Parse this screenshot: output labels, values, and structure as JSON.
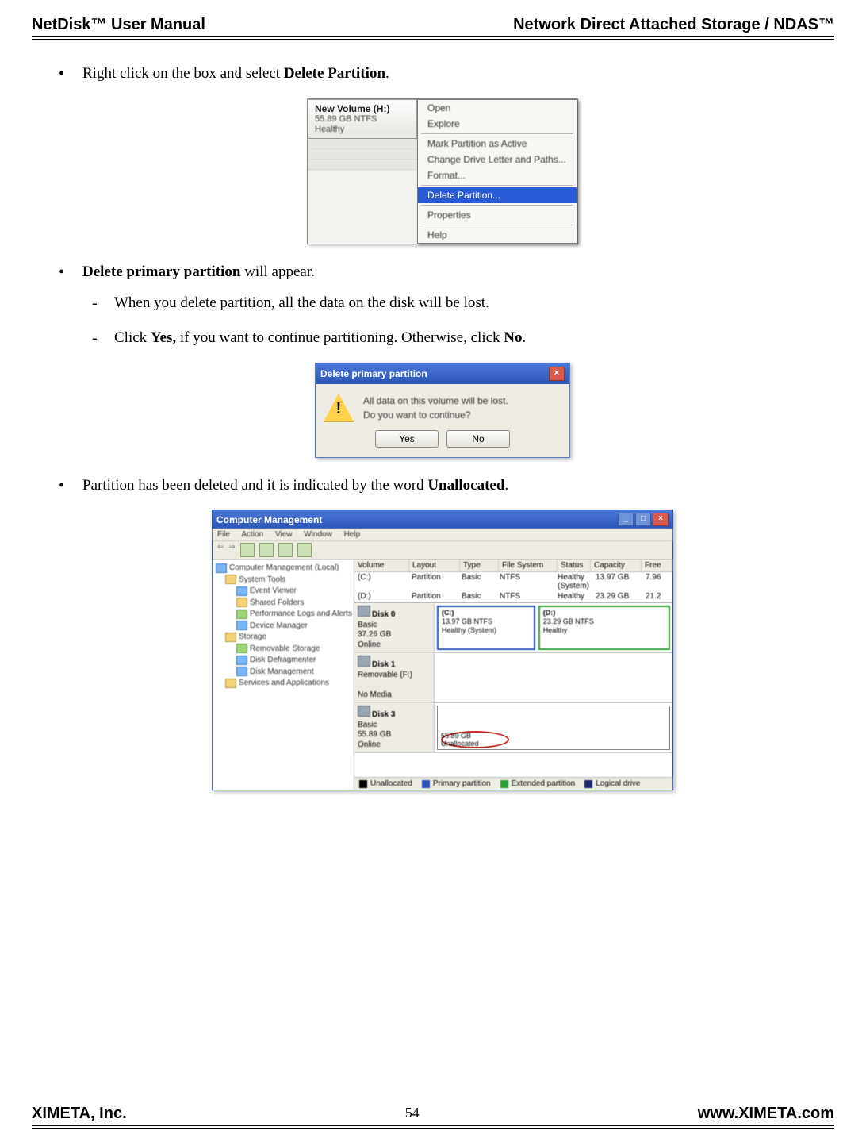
{
  "header": {
    "left": "NetDisk™ User Manual",
    "right": "Network Direct Attached Storage / NDAS™"
  },
  "footer": {
    "left": "XIMETA, Inc.",
    "page": "54",
    "right": "www.XIMETA.com"
  },
  "body": {
    "b1_pre": "Right click on the box and select ",
    "b1_bold": "Delete Partition",
    "b1_post": ".",
    "b2_bold": "Delete primary partition",
    "b2_post": " will appear.",
    "b2_d1": "When you delete partition, all the data on the disk will be lost.",
    "b2_d2_pre": "Click ",
    "b2_d2_bold1": "Yes,",
    "b2_d2_mid": " if you want to continue partitioning.  Otherwise, click ",
    "b2_d2_bold2": "No",
    "b2_d2_post": ".",
    "b3_pre": "Partition has been deleted and it is indicated by the word ",
    "b3_bold": "Unallocated",
    "b3_post": "."
  },
  "ss1": {
    "vol_line1": "New Volume  (H:)",
    "vol_line2": "55.89 GB NTFS",
    "vol_line3": "Healthy",
    "menu": {
      "open": "Open",
      "explore": "Explore",
      "mark": "Mark Partition as Active",
      "change": "Change Drive Letter and Paths...",
      "format": "Format...",
      "delete": "Delete Partition...",
      "properties": "Properties",
      "help": "Help"
    }
  },
  "ss2": {
    "title": "Delete primary partition",
    "msg1": "All data on this volume will be lost.",
    "msg2": "Do you want to continue?",
    "yes": "Yes",
    "no": "No"
  },
  "ss3": {
    "title": "Computer Management",
    "menu": {
      "file": "File",
      "action": "Action",
      "view": "View",
      "window": "Window",
      "help": "Help"
    },
    "tree": {
      "root": "Computer Management (Local)",
      "systools": "System Tools",
      "eventviewer": "Event Viewer",
      "shared": "Shared Folders",
      "perf": "Performance Logs and Alerts",
      "devmgr": "Device Manager",
      "storage": "Storage",
      "removable": "Removable Storage",
      "defrag": "Disk Defragmenter",
      "diskmgmt": "Disk Management",
      "services": "Services and Applications"
    },
    "cols": {
      "volume": "Volume",
      "layout": "Layout",
      "type": "Type",
      "fs": "File System",
      "status": "Status",
      "capacity": "Capacity",
      "free": "Free"
    },
    "rows": [
      {
        "v": "(C:)",
        "l": "Partition",
        "t": "Basic",
        "fs": "NTFS",
        "s": "Healthy (System)",
        "c": "13.97 GB",
        "f": "7.96"
      },
      {
        "v": "(D:)",
        "l": "Partition",
        "t": "Basic",
        "fs": "NTFS",
        "s": "Healthy",
        "c": "23.29 GB",
        "f": "21.2"
      }
    ],
    "disk0": {
      "name": "Disk 0",
      "type": "Basic",
      "size": "37.26 GB",
      "status": "Online",
      "p1_l1": "(C:)",
      "p1_l2": "13.97 GB NTFS",
      "p1_l3": "Healthy (System)",
      "p2_l1": "(D:)",
      "p2_l2": "23.29 GB NTFS",
      "p2_l3": "Healthy"
    },
    "disk1": {
      "name": "Disk 1",
      "type": "Removable (F:)",
      "status": "No Media"
    },
    "disk3": {
      "name": "Disk 3",
      "type": "Basic",
      "size": "55.89 GB",
      "status": "Online",
      "label": "Unallocated",
      "size2": "55.89 GB"
    },
    "legend": {
      "un": "Unallocated",
      "pp": "Primary partition",
      "ep": "Extended partition",
      "ld": "Logical drive"
    }
  }
}
